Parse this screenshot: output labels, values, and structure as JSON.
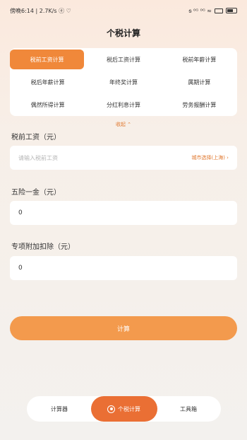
{
  "status_bar": {
    "left_text": "傍晚6:14 | 2.7K/s ⓔ ♡",
    "right_text": "ᵴ ⁰ᴳ ⁰ᴳ ≈"
  },
  "page_title": "个税计算",
  "calc_types": [
    "税前工资计算",
    "税后工资计算",
    "税前年薪计算",
    "税后年薪计算",
    "年终奖计算",
    "属期计算",
    "偶然所得计算",
    "分红利息计算",
    "劳务报酬计算"
  ],
  "collapse_label": "收起 ⌃",
  "fields": {
    "salary": {
      "label": "税前工资（元）",
      "placeholder": "请输入税前工资",
      "city_select": "城市选择(上海) ›"
    },
    "insurance": {
      "label": "五险一金（元）",
      "value": "0"
    },
    "deduction": {
      "label": "专项附加扣除（元）",
      "value": "0"
    }
  },
  "calc_button_label": "计算",
  "bottom_nav": {
    "items": [
      "计算器",
      "个税计算",
      "工具箱"
    ],
    "active_index": 1
  },
  "colors": {
    "accent": "#f0883a",
    "accent_dark": "#ea6f34"
  }
}
